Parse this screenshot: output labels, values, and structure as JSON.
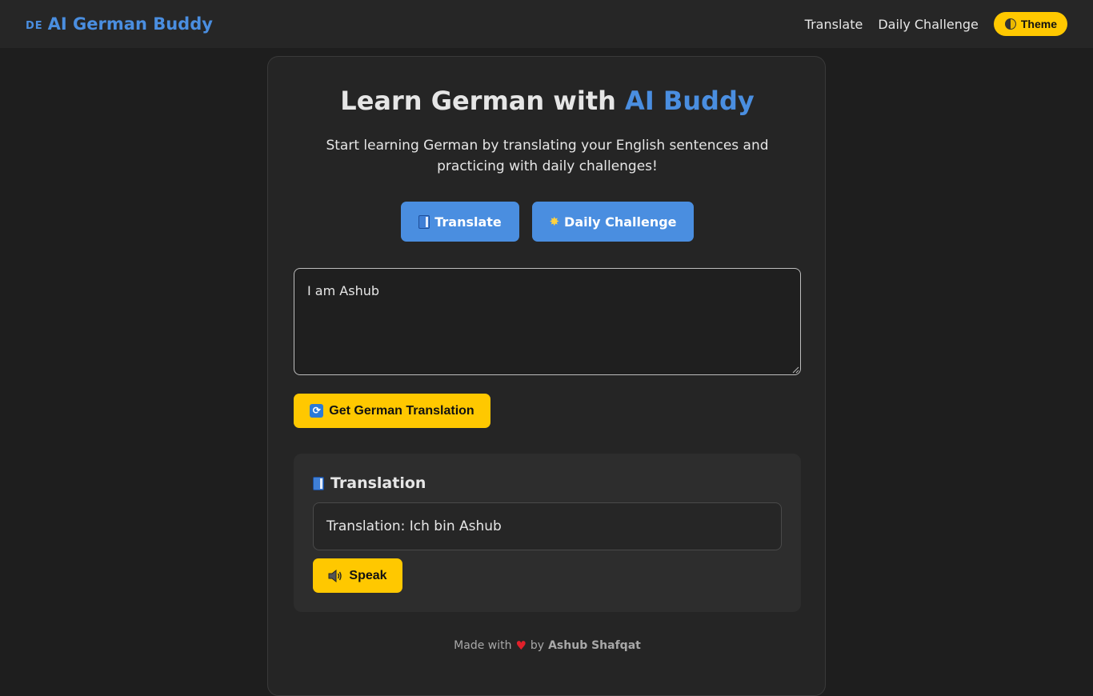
{
  "navbar": {
    "flag_text": "DE",
    "brand": "AI German Buddy",
    "links": [
      "Translate",
      "Daily Challenge"
    ],
    "theme_label": "Theme"
  },
  "hero": {
    "title_prefix": "Learn German with",
    "title_accent": "AI Buddy",
    "subtitle": "Start learning German by translating your English sentences and practicing with daily challenges!"
  },
  "tabs": {
    "translate_label": "Translate",
    "challenge_label": "Daily Challenge"
  },
  "input": {
    "value": "I am Ashub"
  },
  "actions": {
    "get_translation_label": "Get German Translation"
  },
  "result": {
    "heading": "Translation",
    "text": "Translation: Ich bin Ashub",
    "speak_label": "Speak"
  },
  "footer": {
    "made_with": "Made with",
    "by": "by",
    "author": "Ashub Shafqat"
  },
  "colors": {
    "background": "#1e1e1e",
    "navbar": "#262626",
    "card": "#252525",
    "accent_blue": "#4a8ee0",
    "accent_yellow": "#ffc800",
    "heart": "#e0202a"
  },
  "icons": {
    "theme": "half-moon-icon",
    "translate": "book-icon",
    "challenge": "sparkle-star-icon",
    "get_translation": "cycle-arrows-icon",
    "speak": "speaker-icon",
    "footer": "heart-icon"
  }
}
